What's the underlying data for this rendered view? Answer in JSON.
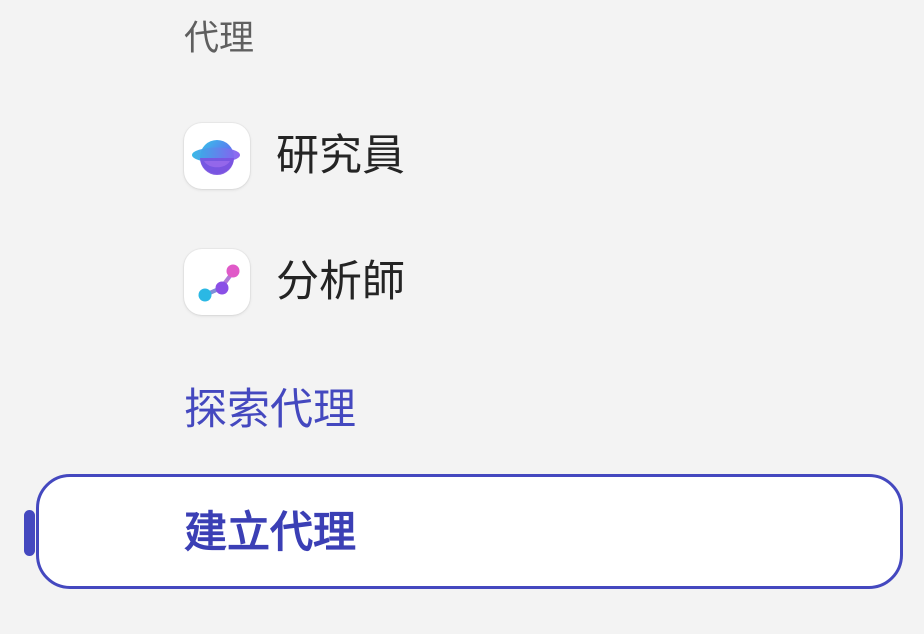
{
  "agents_section": {
    "header": "代理",
    "items": [
      {
        "label": "研究員",
        "icon": "researcher-planet-icon"
      },
      {
        "label": "分析師",
        "icon": "analyst-graph-icon"
      }
    ],
    "explore_label": "探索代理",
    "create_label": "建立代理"
  },
  "colors": {
    "accent": "#4448bf",
    "background": "#f3f3f3",
    "text_primary": "#242424",
    "text_secondary": "#5f5f5f"
  }
}
